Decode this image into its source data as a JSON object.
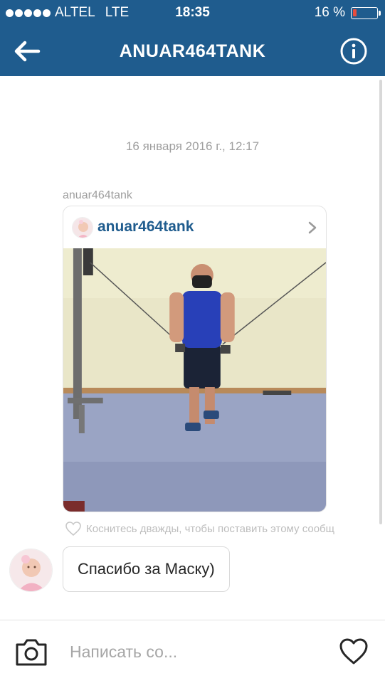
{
  "status_bar": {
    "carrier": "ALTEL",
    "network": "LTE",
    "time": "18:35",
    "battery": "16 %",
    "battery_level": 0.16
  },
  "navbar": {
    "title": "ANUAR464TANK",
    "back_icon": "arrow-left-icon",
    "info_icon": "info-circle-icon"
  },
  "thread": {
    "timestamp": "16 января 2016 г., 12:17",
    "shared_post": {
      "sender": "anuar464tank",
      "username": "anuar464tank",
      "chevron_icon": "chevron-right-icon"
    },
    "like_hint": "Коснитесь дважды, чтобы поставить этому сообщ",
    "reply": {
      "text": "Спасибо за Маску)"
    }
  },
  "composer": {
    "placeholder": "Написать со...",
    "camera_icon": "camera-icon",
    "heart_icon": "heart-icon"
  },
  "colors": {
    "header_bg": "#1f5c8e",
    "username_link": "#1f5c8e",
    "muted_text": "#9e9e9e"
  }
}
